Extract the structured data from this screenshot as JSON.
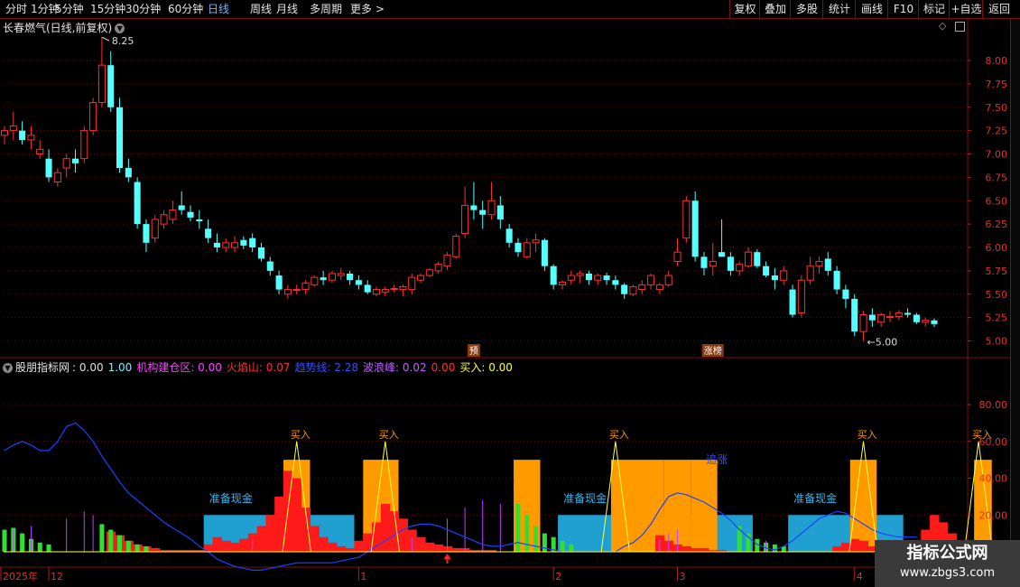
{
  "toolbar": {
    "periods": [
      "分时",
      "1分钟",
      "5分钟",
      "15分钟",
      "30分钟",
      "60分钟",
      "日线",
      "周线",
      "月线",
      "多周期",
      "更多"
    ],
    "active_period": "日线",
    "right_buttons": [
      "复权",
      "叠加",
      "多股",
      "统计",
      "画线",
      "F10",
      "标记",
      "+自选",
      "返回"
    ]
  },
  "price_panel": {
    "title": "长春燃气(日线,前复权)",
    "high_label": "8.25",
    "low_label": "5.00",
    "axis_labels": [
      "8.00",
      "7.75",
      "7.50",
      "7.25",
      "7.00",
      "6.75",
      "6.50",
      "6.25",
      "6.00",
      "5.75",
      "5.50",
      "5.25",
      "5.00"
    ],
    "marker_labels": [
      "预",
      "涨榜"
    ]
  },
  "indicator_panel": {
    "title": "股朋指标网",
    "legend": [
      {
        "text": "0.00",
        "color": "#e0e0e0"
      },
      {
        "text": "1.00",
        "color": "#7ef0ff"
      },
      {
        "text": "机构建仓区: 0.00",
        "color": "#ff40ff"
      },
      {
        "text": "火焰山: 0.07",
        "color": "#ff3030"
      },
      {
        "text": "趋势线: 2.28",
        "color": "#3050ff"
      },
      {
        "text": "波浪峰: 0.02",
        "color": "#c060ff"
      },
      {
        "text": "0.00",
        "color": "#ff3030"
      },
      {
        "text": "买入: 0.00",
        "color": "#ffff40"
      }
    ],
    "axis_labels": [
      "80.00",
      "60.00",
      "40.00",
      "20.00"
    ],
    "buy_label": "买入",
    "cash_label": "准备现金",
    "rise_label": "追涨"
  },
  "time_axis": {
    "labels": [
      "2025年",
      "12",
      "1",
      "2",
      "3",
      "4"
    ]
  },
  "watermark": {
    "line1": "指标公式网",
    "line2": "www.zbgs3.com"
  },
  "chart_data": {
    "type": "candlestick",
    "title": "长春燃气(日线,前复权)",
    "ylim": [
      5.0,
      8.25
    ],
    "x": [
      "2025-11",
      "2025-12",
      "2026-01",
      "2026-02",
      "2026-03",
      "2026-04"
    ],
    "ohlc": [
      [
        7.2,
        7.3,
        7.1,
        7.25
      ],
      [
        7.25,
        7.45,
        7.15,
        7.3
      ],
      [
        7.25,
        7.35,
        7.1,
        7.15
      ],
      [
        7.15,
        7.3,
        7.05,
        7.2
      ],
      [
        7.0,
        7.15,
        6.95,
        7.05
      ],
      [
        6.95,
        7.05,
        6.7,
        6.75
      ],
      [
        6.7,
        6.85,
        6.65,
        6.8
      ],
      [
        6.85,
        7.0,
        6.75,
        6.95
      ],
      [
        6.95,
        7.05,
        6.8,
        6.9
      ],
      [
        6.95,
        7.3,
        6.9,
        7.25
      ],
      [
        7.25,
        7.6,
        7.2,
        7.55
      ],
      [
        7.55,
        8.25,
        7.5,
        7.95
      ],
      [
        7.95,
        8.1,
        7.45,
        7.5
      ],
      [
        7.5,
        7.6,
        6.8,
        6.85
      ],
      [
        6.85,
        6.95,
        6.7,
        6.75
      ],
      [
        6.7,
        6.75,
        6.2,
        6.25
      ],
      [
        6.25,
        6.3,
        5.95,
        6.05
      ],
      [
        6.1,
        6.35,
        6.05,
        6.3
      ],
      [
        6.25,
        6.4,
        6.2,
        6.35
      ],
      [
        6.3,
        6.5,
        6.25,
        6.4
      ],
      [
        6.45,
        6.6,
        6.35,
        6.4
      ],
      [
        6.38,
        6.45,
        6.28,
        6.32
      ],
      [
        6.3,
        6.4,
        6.2,
        6.28
      ],
      [
        6.2,
        6.3,
        6.05,
        6.1
      ],
      [
        6.05,
        6.15,
        5.95,
        6.0
      ],
      [
        6.0,
        6.1,
        5.95,
        6.05
      ],
      [
        6.0,
        6.12,
        5.95,
        6.05
      ],
      [
        6.08,
        6.12,
        5.98,
        6.02
      ],
      [
        6.1,
        6.15,
        5.95,
        6.0
      ],
      [
        6.0,
        6.05,
        5.85,
        5.88
      ],
      [
        5.85,
        5.9,
        5.7,
        5.75
      ],
      [
        5.7,
        5.75,
        5.5,
        5.55
      ],
      [
        5.5,
        5.6,
        5.45,
        5.55
      ],
      [
        5.55,
        5.6,
        5.5,
        5.55
      ],
      [
        5.55,
        5.65,
        5.5,
        5.62
      ],
      [
        5.6,
        5.7,
        5.58,
        5.68
      ],
      [
        5.68,
        5.75,
        5.6,
        5.65
      ],
      [
        5.65,
        5.75,
        5.62,
        5.72
      ],
      [
        5.7,
        5.78,
        5.65,
        5.72
      ],
      [
        5.72,
        5.75,
        5.6,
        5.65
      ],
      [
        5.65,
        5.7,
        5.55,
        5.6
      ],
      [
        5.6,
        5.65,
        5.5,
        5.52
      ],
      [
        5.5,
        5.58,
        5.48,
        5.55
      ],
      [
        5.52,
        5.58,
        5.48,
        5.55
      ],
      [
        5.55,
        5.6,
        5.52,
        5.56
      ],
      [
        5.55,
        5.6,
        5.48,
        5.58
      ],
      [
        5.55,
        5.72,
        5.5,
        5.68
      ],
      [
        5.65,
        5.72,
        5.62,
        5.7
      ],
      [
        5.7,
        5.78,
        5.68,
        5.76
      ],
      [
        5.75,
        5.85,
        5.72,
        5.82
      ],
      [
        5.8,
        5.95,
        5.76,
        5.92
      ],
      [
        5.9,
        6.15,
        5.88,
        6.12
      ],
      [
        6.15,
        6.65,
        6.1,
        6.45
      ],
      [
        6.45,
        6.7,
        6.3,
        6.4
      ],
      [
        6.4,
        6.5,
        6.2,
        6.35
      ],
      [
        6.35,
        6.7,
        6.3,
        6.5
      ],
      [
        6.45,
        6.55,
        6.2,
        6.3
      ],
      [
        6.2,
        6.25,
        6.0,
        6.05
      ],
      [
        6.05,
        6.1,
        5.9,
        5.95
      ],
      [
        5.9,
        6.1,
        5.88,
        6.05
      ],
      [
        6.05,
        6.15,
        5.95,
        6.08
      ],
      [
        6.08,
        6.1,
        5.75,
        5.8
      ],
      [
        5.8,
        5.82,
        5.55,
        5.6
      ],
      [
        5.6,
        5.65,
        5.55,
        5.63
      ],
      [
        5.65,
        5.75,
        5.6,
        5.7
      ],
      [
        5.7,
        5.75,
        5.62,
        5.72
      ],
      [
        5.72,
        5.75,
        5.6,
        5.65
      ],
      [
        5.65,
        5.72,
        5.6,
        5.7
      ],
      [
        5.7,
        5.73,
        5.6,
        5.65
      ],
      [
        5.65,
        5.7,
        5.55,
        5.6
      ],
      [
        5.6,
        5.62,
        5.45,
        5.5
      ],
      [
        5.5,
        5.6,
        5.48,
        5.58
      ],
      [
        5.55,
        5.65,
        5.5,
        5.6
      ],
      [
        5.6,
        5.72,
        5.55,
        5.7
      ],
      [
        5.55,
        5.62,
        5.5,
        5.6
      ],
      [
        5.6,
        5.75,
        5.58,
        5.7
      ],
      [
        5.85,
        6.1,
        5.8,
        5.95
      ],
      [
        6.1,
        6.55,
        6.05,
        6.5
      ],
      [
        6.5,
        6.6,
        5.85,
        5.9
      ],
      [
        5.9,
        5.95,
        5.7,
        5.78
      ],
      [
        5.8,
        6.05,
        5.7,
        5.85
      ],
      [
        5.95,
        6.3,
        5.9,
        5.9
      ],
      [
        5.9,
        5.95,
        5.7,
        5.75
      ],
      [
        5.75,
        5.85,
        5.7,
        5.82
      ],
      [
        5.8,
        6.0,
        5.78,
        5.95
      ],
      [
        5.95,
        5.98,
        5.78,
        5.8
      ],
      [
        5.8,
        5.85,
        5.68,
        5.7
      ],
      [
        5.7,
        5.78,
        5.55,
        5.65
      ],
      [
        5.65,
        5.8,
        5.6,
        5.75
      ],
      [
        5.55,
        5.6,
        5.25,
        5.28
      ],
      [
        5.3,
        5.7,
        5.25,
        5.65
      ],
      [
        5.65,
        5.9,
        5.6,
        5.8
      ],
      [
        5.8,
        5.9,
        5.72,
        5.85
      ],
      [
        5.88,
        5.95,
        5.7,
        5.75
      ],
      [
        5.75,
        5.8,
        5.5,
        5.55
      ],
      [
        5.55,
        5.6,
        5.35,
        5.45
      ],
      [
        5.45,
        5.5,
        5.05,
        5.1
      ],
      [
        5.1,
        5.32,
        5.0,
        5.28
      ],
      [
        5.28,
        5.35,
        5.15,
        5.22
      ],
      [
        5.2,
        5.3,
        5.15,
        5.28
      ],
      [
        5.25,
        5.32,
        5.2,
        5.26
      ],
      [
        5.26,
        5.33,
        5.22,
        5.3
      ],
      [
        5.3,
        5.35,
        5.25,
        5.28
      ],
      [
        5.28,
        5.3,
        5.18,
        5.2
      ],
      [
        5.2,
        5.25,
        5.15,
        5.22
      ],
      [
        5.22,
        5.24,
        5.15,
        5.18
      ]
    ],
    "indicator": {
      "ylim": [
        0,
        100
      ],
      "cash_zones": [
        [
          23,
          39
        ],
        [
          63,
          84
        ],
        [
          89,
          101
        ]
      ],
      "orange_bars": [
        [
          32,
          34
        ],
        [
          41,
          44
        ],
        [
          58,
          60
        ],
        [
          69,
          74
        ],
        [
          75,
          77
        ],
        [
          78,
          80
        ],
        [
          96,
          98
        ],
        [
          110,
          111
        ]
      ],
      "buy_peaks": [
        33,
        43,
        69,
        97,
        110
      ],
      "green_bars": {
        "0": 12,
        "1": 13,
        "2": 10,
        "3": 7,
        "4": 5,
        "5": 4,
        "11": 15,
        "12": 12,
        "13": 9,
        "14": 6,
        "15": 4,
        "16": 3,
        "58": 26,
        "59": 20,
        "60": 14,
        "61": 10,
        "62": 8,
        "63": 6,
        "64": 4,
        "83": 14,
        "84": 10,
        "85": 7,
        "86": 5,
        "87": 4,
        "88": 3,
        "105": 6,
        "106": 4,
        "107": 3
      },
      "red_profile": [
        0,
        0,
        0,
        0,
        0,
        0,
        0,
        0,
        0,
        0,
        0,
        0,
        11,
        9,
        6,
        4,
        3,
        2,
        1,
        1,
        1,
        1,
        1,
        4,
        8,
        6,
        5,
        7,
        10,
        14,
        20,
        30,
        44,
        40,
        24,
        14,
        8,
        5,
        3,
        2,
        6,
        10,
        16,
        26,
        22,
        18,
        12,
        8,
        5,
        4,
        3,
        2,
        2,
        1,
        1,
        1,
        0,
        0,
        0,
        0,
        0,
        0,
        0,
        0,
        0,
        0,
        0,
        0,
        0,
        0,
        0,
        0,
        0,
        0,
        9,
        6,
        4,
        3,
        2,
        2,
        1,
        1,
        0,
        0,
        0,
        0,
        0,
        0,
        0,
        0,
        0,
        0,
        0,
        0,
        3,
        5,
        7,
        6,
        3,
        2,
        1,
        1,
        1,
        0,
        12,
        20,
        16,
        10,
        6,
        4,
        2,
        1
      ],
      "trend": [
        55,
        58,
        60,
        58,
        55,
        55,
        60,
        68,
        70,
        66,
        60,
        52,
        45,
        38,
        32,
        28,
        24,
        20,
        16,
        13,
        10,
        7,
        3,
        0,
        -4,
        -6,
        -8,
        -9,
        -10,
        -10,
        -9,
        -8,
        -7,
        -6,
        -6,
        -6,
        -6,
        -6,
        -5,
        -4,
        -3,
        0,
        3,
        6,
        9,
        12,
        14,
        15,
        15,
        14,
        12,
        10,
        8,
        6,
        4,
        3,
        3,
        4,
        5,
        4,
        3,
        2,
        1,
        0,
        0,
        0,
        0,
        0,
        0,
        0,
        3,
        5,
        9,
        15,
        23,
        30,
        32,
        31,
        29,
        27,
        24,
        21,
        17,
        12,
        8,
        4,
        2,
        1,
        3,
        6,
        10,
        14,
        18,
        20,
        22,
        21,
        18,
        15,
        12,
        10,
        9,
        8,
        8,
        8
      ],
      "purple_lines": {
        "1": 12,
        "3": 14,
        "7": 18,
        "9": 22,
        "10": 20,
        "28": 7,
        "46": 8,
        "50": 18,
        "52": 24,
        "54": 28,
        "56": 26,
        "74": 7,
        "75": 10,
        "76": 12,
        "86": 6,
        "99": 8,
        "100": 6
      }
    }
  }
}
